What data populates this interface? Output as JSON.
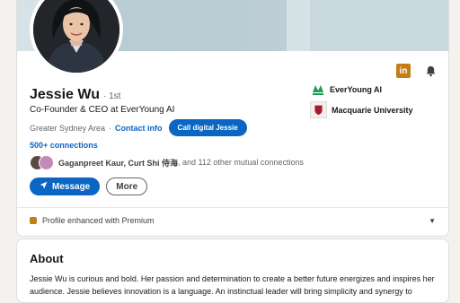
{
  "profile": {
    "name": "Jessie Wu",
    "degree": "· 1st",
    "headline": "Co-Founder & CEO at EverYoung AI",
    "location": "Greater Sydney Area",
    "separator": "·",
    "contact_info": "Contact info",
    "call_button": "Call digital Jessie",
    "connections": "500+ connections",
    "mutual_names": "Gaganpreet Kaur, Curt Shi 侍海",
    "mutual_rest": ", and 112 other mutual connections",
    "message_button": "Message",
    "more_button": "More",
    "premium_text": "Profile enhanced with Premium"
  },
  "top_icons": {
    "linkedin_glyph": "in"
  },
  "organizations": [
    {
      "name": "EverYoung AI",
      "icon": "everyoung-logo"
    },
    {
      "name": "Macquarie University",
      "icon": "macquarie-logo"
    }
  ],
  "about": {
    "title": "About",
    "text": "Jessie Wu is curious and bold. Her passion and determination to create a better future energizes and inspires her audience. Jessie believes innovation is a language. An instinctual leader will bring simplicity and synergy to process"
  },
  "colors": {
    "accent": "#0a66c2",
    "premium_gold": "#c37d16",
    "page_bg": "#f4f2ee"
  }
}
